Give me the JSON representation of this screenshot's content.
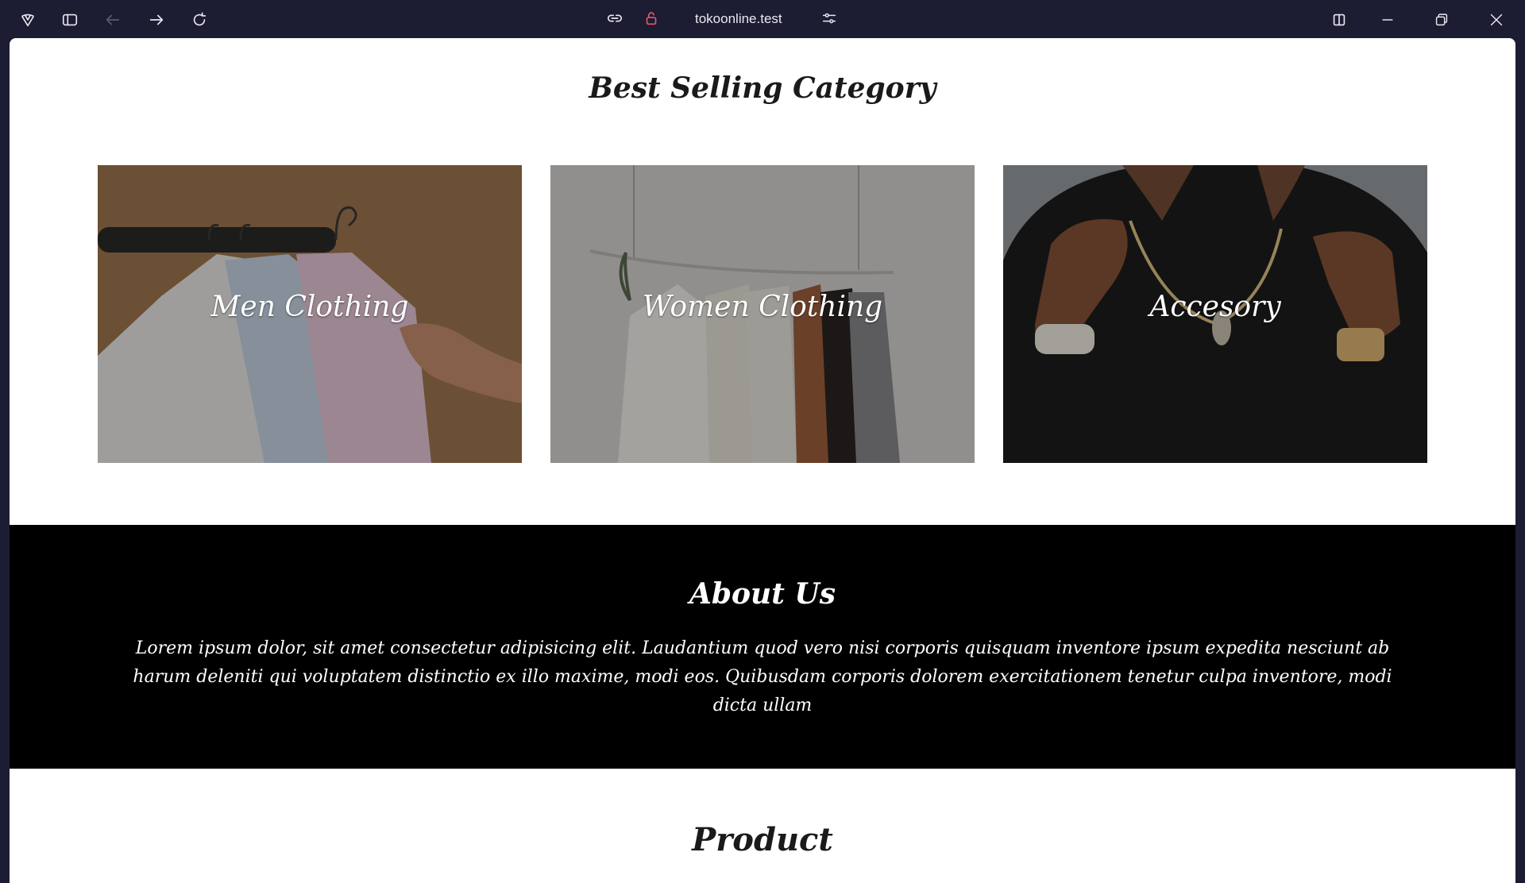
{
  "browser": {
    "url": "tokoonline.test",
    "icons": [
      "app-logo-icon",
      "sidebar-toggle-icon",
      "back-icon",
      "forward-icon",
      "reload-icon",
      "link-icon",
      "lock-icon",
      "site-settings-icon",
      "split-view-icon",
      "minimize-icon",
      "restore-icon",
      "close-icon"
    ]
  },
  "best_selling": {
    "title": "Best Selling Category",
    "categories": [
      {
        "label": "Men Clothing"
      },
      {
        "label": "Women Clothing"
      },
      {
        "label": "Accesory"
      }
    ]
  },
  "about": {
    "title": "About Us",
    "text": "Lorem ipsum dolor, sit amet consectetur adipisicing elit. Laudantium quod vero nisi corporis quisquam inventore ipsum expedita nesciunt ab harum deleniti qui voluptatem distinctio ex illo maxime, modi eos. Quibusdam corporis dolorem exercitationem tenetur culpa inventore, modi dicta ullam"
  },
  "product": {
    "title": "Product"
  },
  "colors": {
    "chrome_bg": "#1c1c32",
    "page_bg": "#ffffff",
    "about_bg": "#000000",
    "lock_accent": "#e05a6a"
  }
}
